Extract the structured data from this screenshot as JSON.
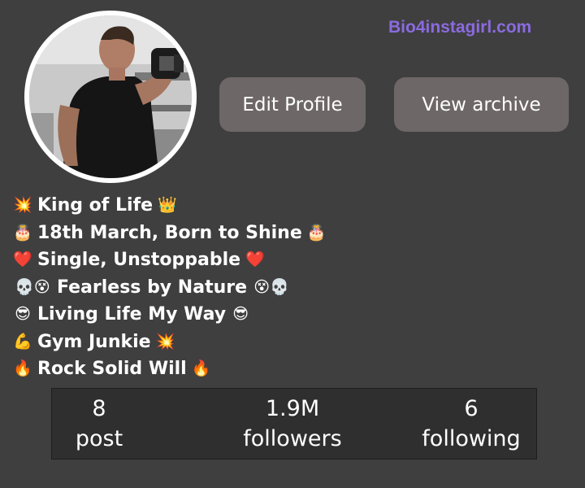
{
  "watermark": "Bio4instagirl.com",
  "buttons": {
    "edit_profile": "Edit Profile",
    "view_archive": "View archive"
  },
  "avatar": {
    "description_icon": "profile-photo-gym-man-icon"
  },
  "bio": [
    {
      "pre": "💥",
      "text": "King of Life",
      "post": "👑"
    },
    {
      "pre": "🎂",
      "text": "18th March, Born to Shine",
      "post": "🎂"
    },
    {
      "pre": "❤️",
      "text": "Single, Unstoppable",
      "post": "❤️"
    },
    {
      "pre": "💀😵",
      "text": "Fearless by Nature",
      "post": "😵💀"
    },
    {
      "pre": "😎",
      "text": "Living Life My Way",
      "post": "😎"
    },
    {
      "pre": "💪",
      "text": "Gym Junkie",
      "post": "💥"
    },
    {
      "pre": "🔥",
      "text": "Rock Solid Will",
      "post": "🔥"
    }
  ],
  "stats": {
    "posts": {
      "value": "8",
      "label": "post"
    },
    "followers": {
      "value": "1.9M",
      "label": "followers"
    },
    "following": {
      "value": "6",
      "label": "following"
    }
  },
  "colors": {
    "background": "#3f3f3f",
    "button": "#6e6767",
    "watermark": "#8b6be0",
    "stats_box": "#2f2f2f"
  }
}
